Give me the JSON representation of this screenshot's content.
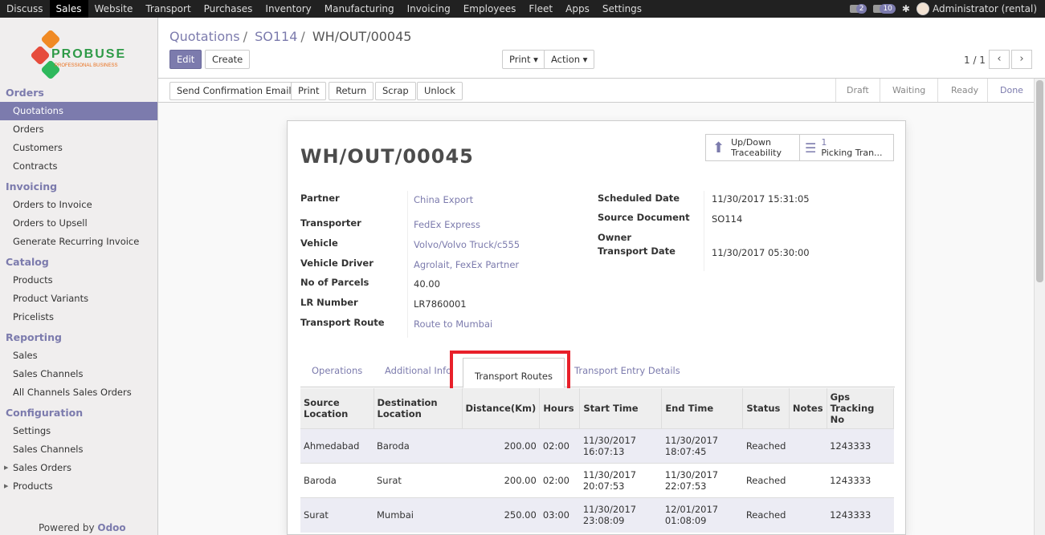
{
  "topbar": {
    "menu": [
      "Discuss",
      "Sales",
      "Website",
      "Transport",
      "Purchases",
      "Inventory",
      "Manufacturing",
      "Invoicing",
      "Employees",
      "Fleet",
      "Apps",
      "Settings"
    ],
    "active_menu": "Sales",
    "chat_count": "2",
    "activity_count": "10",
    "user": "Administrator (rental)"
  },
  "logo": {
    "word": "PROBUSE",
    "tagline": "PROFESSIONAL BUSINESS"
  },
  "sidebar": {
    "sections": [
      {
        "title": "Orders",
        "items": [
          "Quotations",
          "Orders",
          "Customers",
          "Contracts"
        ]
      },
      {
        "title": "Invoicing",
        "items": [
          "Orders to Invoice",
          "Orders to Upsell",
          "Generate Recurring Invoice"
        ]
      },
      {
        "title": "Catalog",
        "items": [
          "Products",
          "Product Variants",
          "Pricelists"
        ]
      },
      {
        "title": "Reporting",
        "items": [
          "Sales",
          "Sales Channels",
          "All Channels Sales Orders"
        ]
      },
      {
        "title": "Configuration",
        "items": [
          "Settings",
          "Sales Channels",
          "Sales Orders",
          "Products"
        ]
      }
    ],
    "active_item": "Quotations",
    "powered_prefix": "Powered by",
    "powered_brand": "Odoo"
  },
  "breadcrumb": {
    "first": "Quotations",
    "second": "SO114",
    "current": "WH/OUT/00045"
  },
  "buttons": {
    "edit": "Edit",
    "create": "Create",
    "print": "Print ▾",
    "action": "Action ▾",
    "send_confirmation": "Send Confirmation Email",
    "print2": "Print",
    "return": "Return",
    "scrap": "Scrap",
    "unlock": "Unlock"
  },
  "pager": "1 / 1",
  "stages": [
    "Draft",
    "Waiting",
    "Ready",
    "Done"
  ],
  "record": {
    "title": "WH/OUT/00045",
    "smart_buttons": {
      "traceability_l1": "Up/Down",
      "traceability_l2": "Traceability",
      "picking_count": "1",
      "picking_label": "Picking Tran..."
    },
    "left_fields": [
      {
        "label": "Partner",
        "value": "China Export",
        "link": true
      },
      {
        "label": "Transporter",
        "value": "FedEx Express",
        "link": true
      },
      {
        "label": "Vehicle",
        "value": "Volvo/Volvo Truck/c555",
        "link": true
      },
      {
        "label": "Vehicle Driver",
        "value": "Agrolait, FexEx Partner",
        "link": true
      },
      {
        "label": "No of Parcels",
        "value": "40.00",
        "link": false
      },
      {
        "label": "LR Number",
        "value": "LR7860001",
        "link": false
      },
      {
        "label": "Transport Route",
        "value": "Route to Mumbai",
        "link": true
      }
    ],
    "right_fields": [
      {
        "label": "Scheduled Date",
        "value": "11/30/2017 15:31:05"
      },
      {
        "label": "Source Document",
        "value": "SO114"
      },
      {
        "label": "Owner",
        "value": ""
      },
      {
        "label": "Transport Date",
        "value": "11/30/2017 05:30:00"
      }
    ]
  },
  "tabs": [
    "Operations",
    "Additional Info",
    "Transport Routes",
    "Transport Entry Details"
  ],
  "active_tab": "Transport Routes",
  "table": {
    "headers": [
      "Source Location",
      "Destination Location",
      "Distance(Km)",
      "Hours",
      "Start Time",
      "End Time",
      "Status",
      "Notes",
      "Gps Tracking No"
    ],
    "rows": [
      [
        "Ahmedabad",
        "Baroda",
        "200.00",
        "02:00",
        "11/30/2017 16:07:13",
        "11/30/2017 18:07:45",
        "Reached",
        "",
        "1243333"
      ],
      [
        "Baroda",
        "Surat",
        "200.00",
        "02:00",
        "11/30/2017 20:07:53",
        "11/30/2017 22:07:53",
        "Reached",
        "",
        "1243333"
      ],
      [
        "Surat",
        "Mumbai",
        "250.00",
        "03:00",
        "11/30/2017 23:08:09",
        "12/01/2017 01:08:09",
        "Reached",
        "",
        "1243333"
      ]
    ]
  }
}
